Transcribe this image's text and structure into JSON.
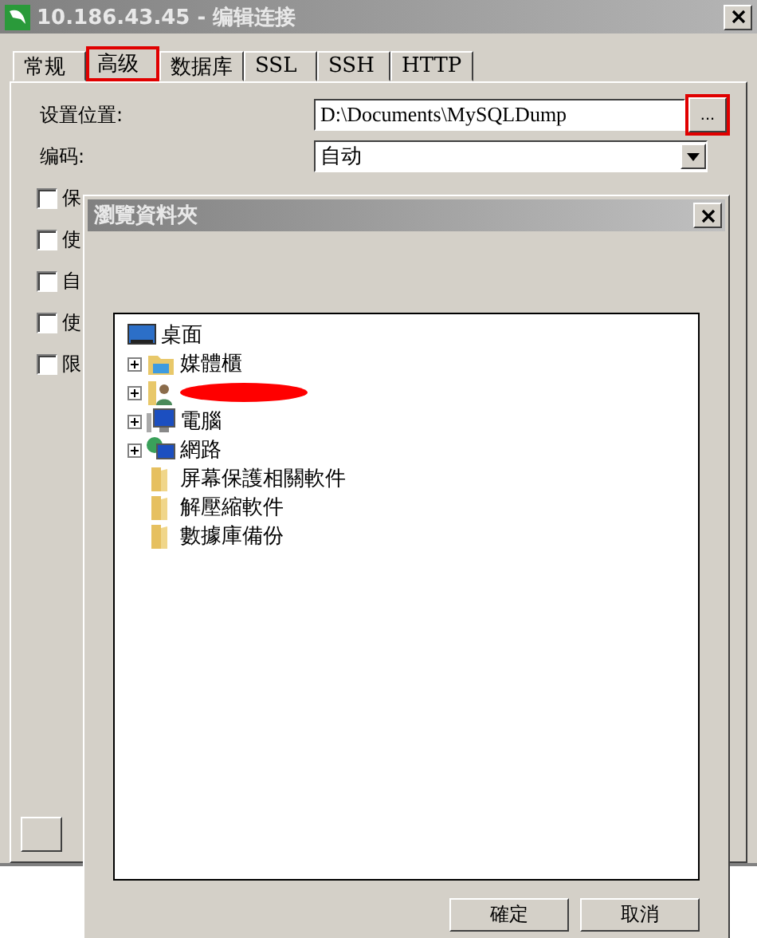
{
  "window": {
    "title": "10.186.43.45 - 编辑连接"
  },
  "tabs": [
    {
      "label": "常规",
      "selected": false,
      "highlighted": false
    },
    {
      "label": "高级",
      "selected": true,
      "highlighted": true
    },
    {
      "label": "数据库",
      "selected": false,
      "highlighted": false
    },
    {
      "label": "SSL",
      "selected": false,
      "highlighted": false
    },
    {
      "label": "SSH",
      "selected": false,
      "highlighted": false
    },
    {
      "label": "HTTP",
      "selected": false,
      "highlighted": false
    }
  ],
  "location": {
    "label": "设置位置:",
    "value": "D:\\Documents\\MySQLDump",
    "browse": "...",
    "browse_highlighted": true
  },
  "encoding": {
    "label": "编码:",
    "value": "自动"
  },
  "options": [
    {
      "label": "保",
      "checked": false
    },
    {
      "label": "使",
      "checked": false
    },
    {
      "label": "自",
      "checked": false
    },
    {
      "label": "使",
      "checked": false
    },
    {
      "label": "限",
      "checked": false
    }
  ],
  "dialog": {
    "title": "瀏覽資料夾",
    "tree": {
      "label": "桌面",
      "kind": "desktop",
      "children": [
        {
          "label": "媒體櫃",
          "kind": "library",
          "expandable": true
        },
        {
          "kind": "user",
          "expandable": true,
          "redacted": true
        },
        {
          "label": "電腦",
          "kind": "computer",
          "expandable": true
        },
        {
          "label": "網路",
          "kind": "network",
          "expandable": true
        },
        {
          "label": "屏幕保護相關軟件",
          "kind": "folder",
          "expandable": false
        },
        {
          "label": "解壓縮軟件",
          "kind": "folder",
          "expandable": false
        },
        {
          "label": "數據庫備份",
          "kind": "folder",
          "expandable": false
        }
      ]
    },
    "buttons": [
      "確定",
      "取消"
    ]
  }
}
